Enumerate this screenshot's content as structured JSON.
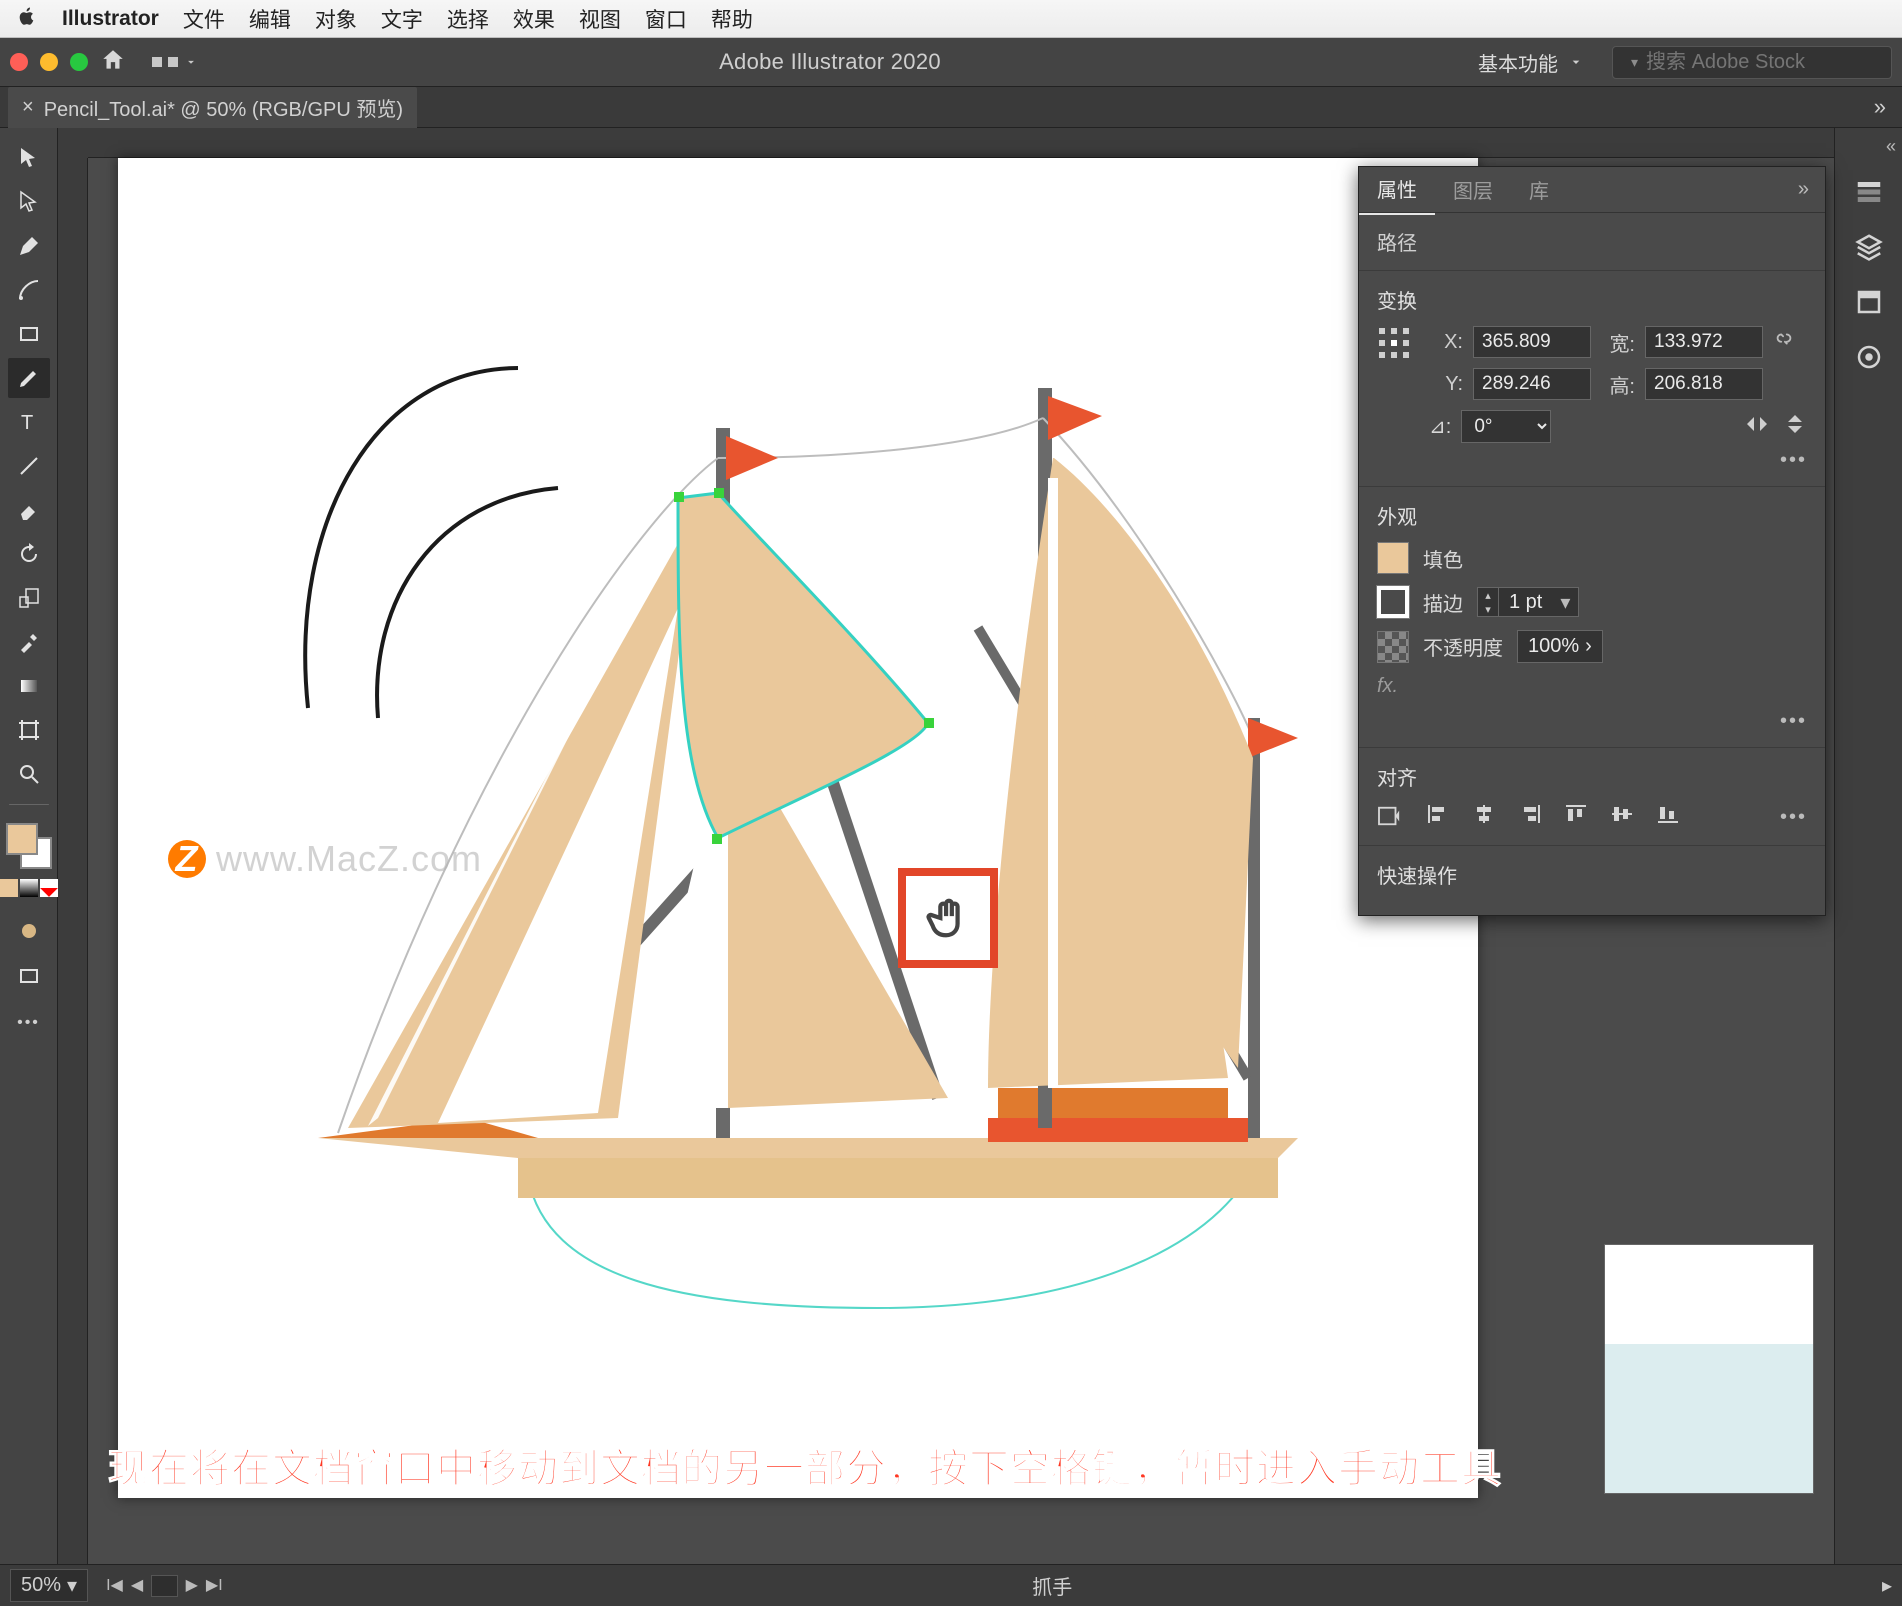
{
  "mac_menu": {
    "app": "Illustrator",
    "items": [
      "文件",
      "编辑",
      "对象",
      "文字",
      "选择",
      "效果",
      "视图",
      "窗口",
      "帮助"
    ]
  },
  "titlebar": {
    "title": "Adobe Illustrator 2020"
  },
  "workspace": {
    "label": "基本功能"
  },
  "search": {
    "placeholder": "搜索 Adobe Stock"
  },
  "document_tab": {
    "label": "Pencil_Tool.ai* @ 50% (RGB/GPU 预览)"
  },
  "properties": {
    "tabs": {
      "props": "属性",
      "layers": "图层",
      "libs": "库"
    },
    "selection_type": "路径",
    "transform": {
      "heading": "变换",
      "x_label": "X:",
      "x": "365.809",
      "y_label": "Y:",
      "y": "289.246",
      "w_label": "宽:",
      "w": "133.972",
      "h_label": "高:",
      "h": "206.818",
      "angle_label": "⊿:",
      "angle": "0°"
    },
    "appearance": {
      "heading": "外观",
      "fill_label": "填色",
      "stroke_label": "描边",
      "stroke_value": "1 pt",
      "opacity_label": "不透明度",
      "opacity_value": "100%",
      "fx_label": "fx."
    },
    "align": {
      "heading": "对齐"
    },
    "quick_actions": {
      "heading": "快速操作"
    }
  },
  "statusbar": {
    "zoom": "50%",
    "tool": "抓手"
  },
  "caption": "现在将在文档窗口中移动到文档的另一部分，按下空格键，暂时进入手动工具",
  "watermark": "www.MacZ.com",
  "colors": {
    "sail": "#eac89b",
    "flag": "#e8552f",
    "mast": "#6a6a6a",
    "hull": "#e5c28c",
    "deck": "#e07a2e",
    "path": "#55d7c8"
  }
}
